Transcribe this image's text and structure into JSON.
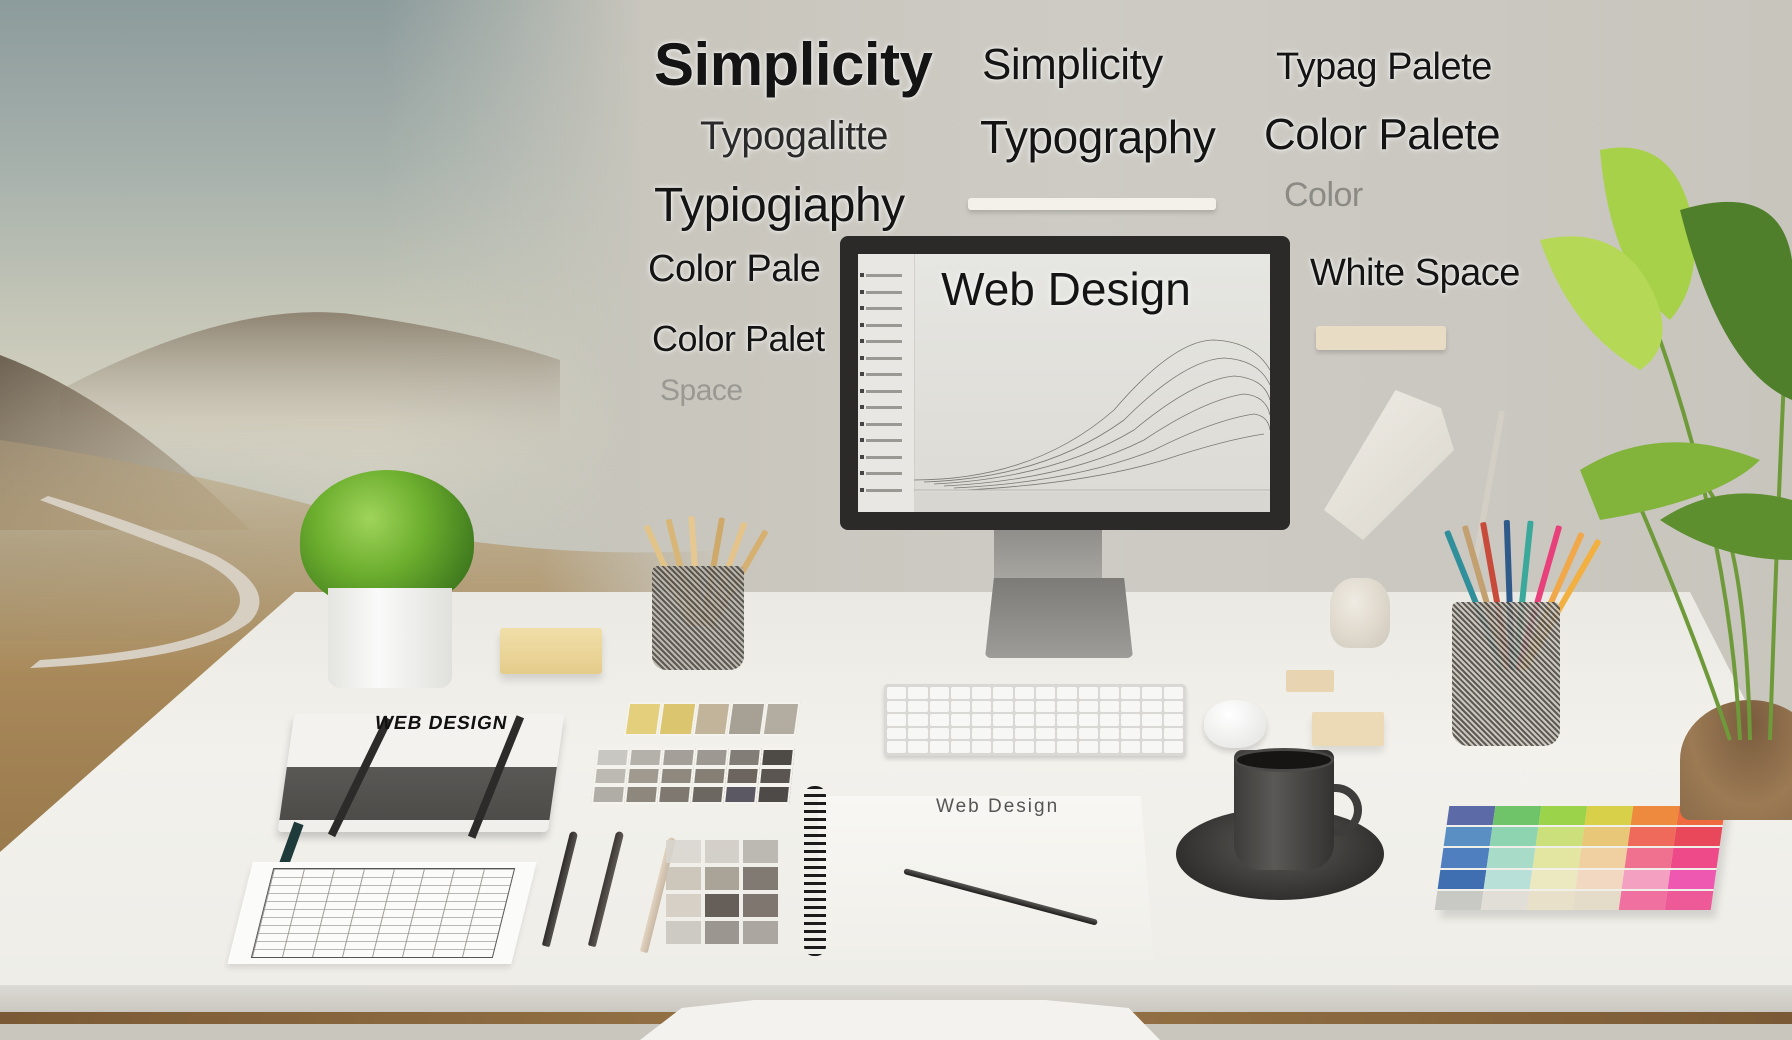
{
  "scene": {
    "description": "Minimalist web design workspace desk scene",
    "colors": {
      "wall": "#c9c6bd",
      "desk": "#f0efea",
      "monitor_bezel": "#2b2a28",
      "text": "#141414",
      "plant_green": "#6cae2e",
      "grass": "#a58a5a"
    }
  },
  "wall_text": [
    {
      "id": "simplicity-1",
      "text": "Simplicity"
    },
    {
      "id": "simplicity-2",
      "text": "Simplicity"
    },
    {
      "id": "typag-palete",
      "text": "Typag Palete"
    },
    {
      "id": "typogalitte",
      "text": "Typogalitte"
    },
    {
      "id": "typography-1",
      "text": "Typography"
    },
    {
      "id": "color-palete-1",
      "text": "Color Palete"
    },
    {
      "id": "typography-2",
      "text": "Typiogiaphy"
    },
    {
      "id": "color-1",
      "text": "Color"
    },
    {
      "id": "color-pale",
      "text": "Color Pale"
    },
    {
      "id": "white-space",
      "text": "White Space"
    },
    {
      "id": "color-palet",
      "text": "Color Palet"
    },
    {
      "id": "space",
      "text": "Space"
    }
  ],
  "monitor": {
    "screen_title": "Web Design",
    "sidebar_items": 14
  },
  "notebook_left": {
    "title": "WEB DESIGN"
  },
  "spiral_notebook": {
    "title": "Web Design"
  },
  "swatches": {
    "warm_row": [
      "#e3cf7c",
      "#dcc56f",
      "#c2b49a",
      "#a7a195",
      "#b3aca0"
    ],
    "neutral_grid": [
      [
        "#c9c7c2",
        "#b4b1ab",
        "#a49f98",
        "#9d9891",
        "#827d76",
        "#4e4a45"
      ],
      [
        "#bcb9b3",
        "#9f998f",
        "#8f887f",
        "#867f76",
        "#6b655e",
        "#5a5550"
      ],
      [
        "#b0aca6",
        "#8d877e",
        "#7e7870",
        "#6c6761",
        "#5b5763",
        "#4d4a47"
      ]
    ],
    "desk_grid": [
      [
        "#d9d6d0",
        "#cfcbc4",
        "#b4b0a9"
      ],
      [
        "#c8c0b3",
        "#9e968a",
        "#6d665e"
      ],
      [
        "#d2cbc1",
        "#4d4640",
        "#6b625a"
      ],
      [
        "#c8c4be",
        "#8d8881",
        "#a09a93"
      ]
    ]
  },
  "color_fan": [
    [
      "#5c6aa8",
      "#6fc46a",
      "#9bd44a",
      "#d8d048",
      "#ee8a3e",
      "#ef6a3e"
    ],
    [
      "#5a8fc4",
      "#8fd4b0",
      "#cbe07a",
      "#e8c878",
      "#ef6a5a",
      "#e8485a"
    ],
    [
      "#4f7fbf",
      "#a8dcc8",
      "#e2e6a0",
      "#f0d0a0",
      "#f07090",
      "#ee4a8a"
    ],
    [
      "#3f6fb0",
      "#b8e0d8",
      "#ece8c0",
      "#f2d8c0",
      "#f4a0c0",
      "#ee58b0"
    ],
    [
      "#c8c8c4",
      "#e0ded6",
      "#e8e0c8",
      "#e4dcc8",
      "#f070a0",
      "#ee5a98"
    ]
  ],
  "pencils_left": [
    "#e2c488",
    "#d8b678",
    "#e6c890",
    "#cfa96a",
    "#e4c48a",
    "#d6b070"
  ],
  "pencils_right": [
    "#2f8f9a",
    "#c2a070",
    "#c84a3a",
    "#2e5a8a",
    "#3aa89a",
    "#e8407a",
    "#f0a84a",
    "#f2b040"
  ]
}
